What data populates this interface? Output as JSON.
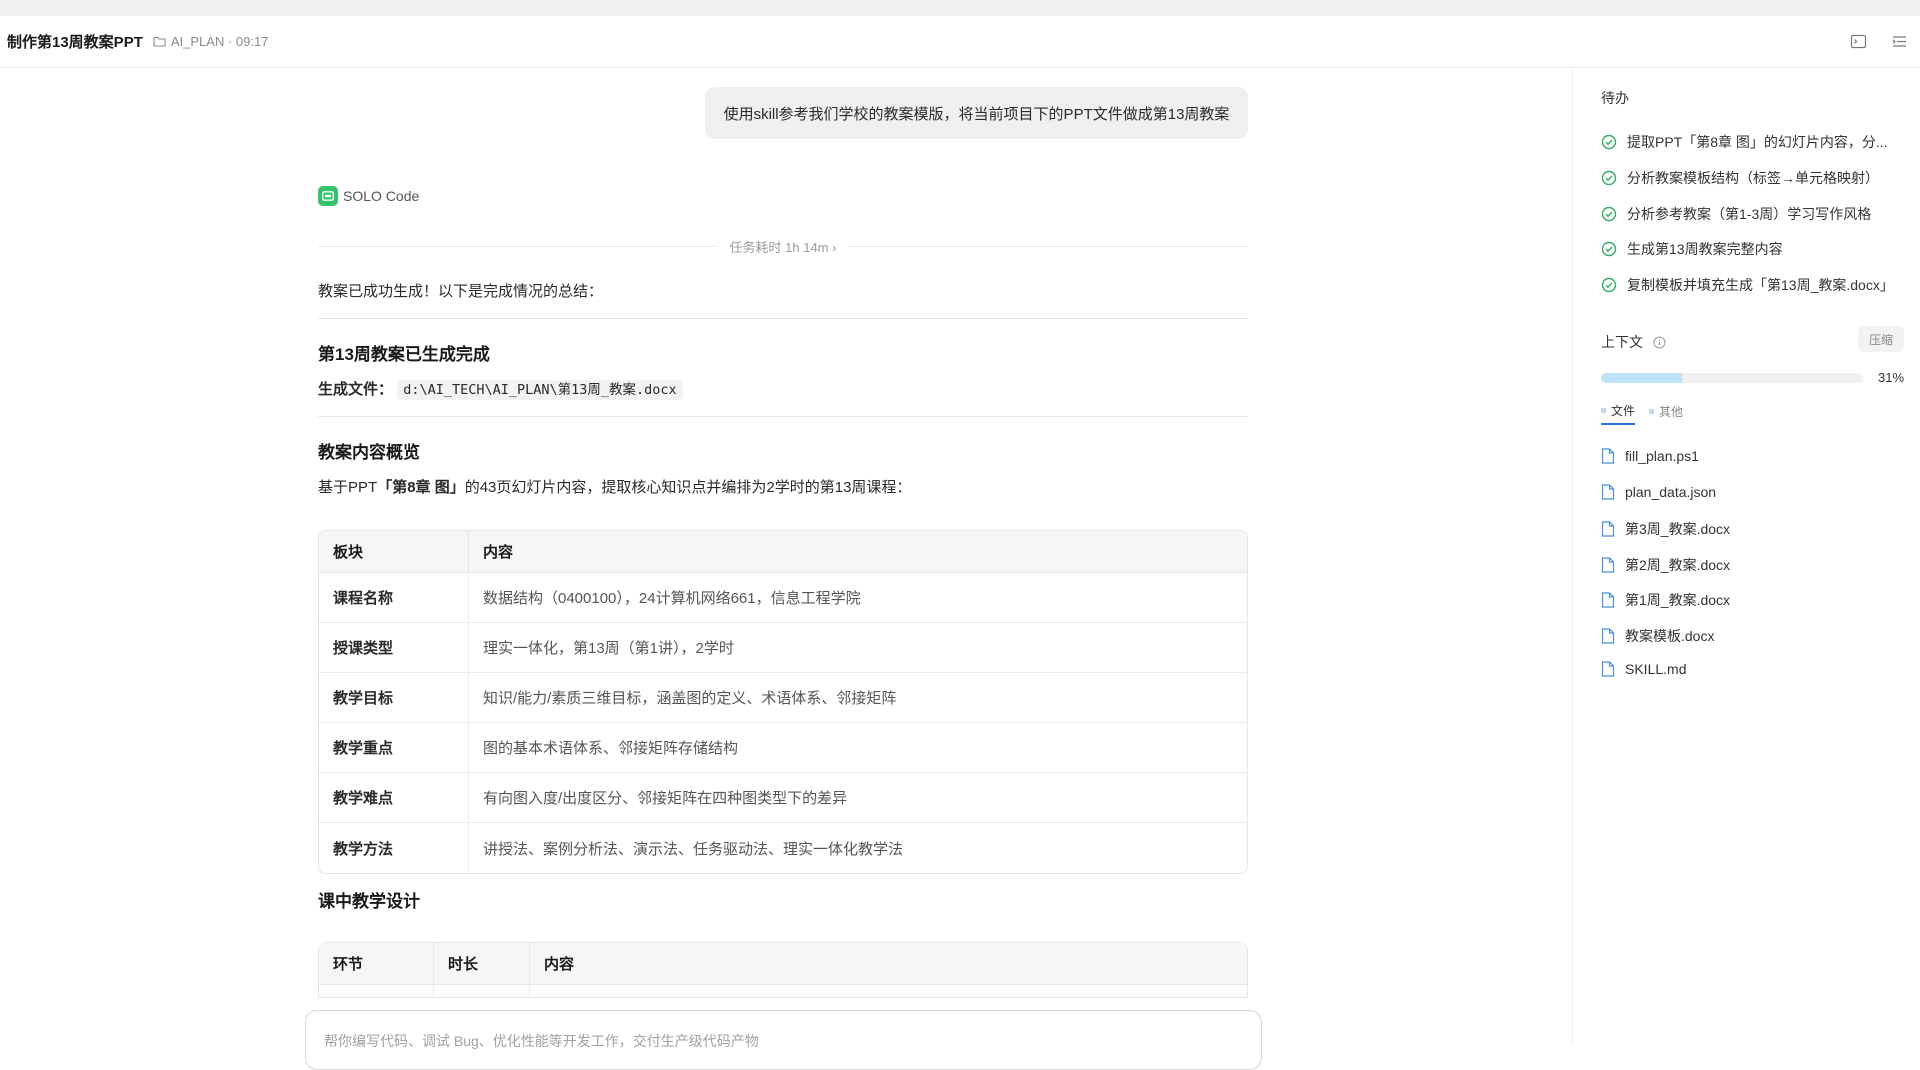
{
  "header": {
    "title": "制作第13周教案PPT",
    "folder": "AI_PLAN · 09:17"
  },
  "chat": {
    "user_message": "使用skill参考我们学校的教案模版，将当前项目下的PPT文件做成第13周教案",
    "agent_name": "SOLO Code",
    "duration": "任务耗时 1h 14m",
    "intro": "教案已成功生成！以下是完成情况的总结：",
    "heading1": "第13周教案已生成完成",
    "file_label": "生成文件",
    "file_path": "d:\\AI_TECH\\AI_PLAN\\第13周_教案.docx",
    "heading2": "教案内容概览",
    "overview_prefix": "基于PPT",
    "overview_bold": "「第8章 图」",
    "overview_suffix": "的43页幻灯片内容，提取核心知识点并编排为2学时的第13周课程：",
    "table1": {
      "headers": [
        "板块",
        "内容"
      ],
      "rows": [
        [
          "课程名称",
          "数据结构（0400100），24计算机网络661，信息工程学院"
        ],
        [
          "授课类型",
          "理实一体化，第13周（第1讲），2学时"
        ],
        [
          "教学目标",
          "知识/能力/素质三维目标，涵盖图的定义、术语体系、邻接矩阵"
        ],
        [
          "教学重点",
          "图的基本术语体系、邻接矩阵存储结构"
        ],
        [
          "教学难点",
          "有向图入度/出度区分、邻接矩阵在四种图类型下的差异"
        ],
        [
          "教学方法",
          "讲授法、案例分析法、演示法、任务驱动法、理实一体化教学法"
        ]
      ]
    },
    "heading3": "课中教学设计",
    "table2": {
      "headers": [
        "环节",
        "时长",
        "内容"
      ]
    },
    "composer_placeholder": "帮你编写代码、调试 Bug、优化性能等开发工作，交付生产级代码产物"
  },
  "sidebar": {
    "todo_title": "待办",
    "todos": [
      "提取PPT「第8章 图」的幻灯片内容，分...",
      "分析教案模板结构（标签→单元格映射）",
      "分析参考教案（第1-3周）学习写作风格",
      "生成第13周教案完整内容",
      "复制模板并填充生成「第13周_教案.docx」"
    ],
    "context_title": "上下文",
    "compress_label": "压缩",
    "context_progress": 31,
    "context_percent_text": "31%",
    "tabs": [
      "文件",
      "其他"
    ],
    "files": [
      "fill_plan.ps1",
      "plan_data.json",
      "第3周_教案.docx",
      "第2周_教案.docx",
      "第1周_教案.docx",
      "教案模板.docx",
      "SKILL.md"
    ],
    "colors": {
      "check": "#2fae64",
      "file_icon": "#4a8fe0",
      "progress": "#bfe3f7",
      "agent_badge": "#35c26b"
    }
  }
}
